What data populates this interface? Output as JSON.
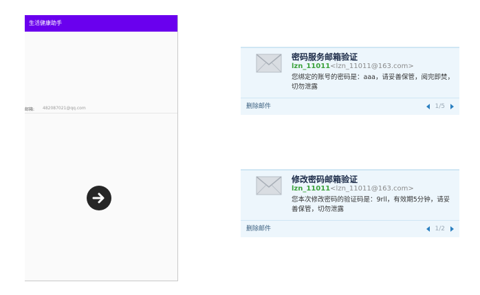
{
  "app": {
    "title": "生活健康助手",
    "email_label": "邮箱:",
    "email_value": "482087021@qq.com"
  },
  "mails": [
    {
      "subject": "密码服务邮箱验证",
      "sender_name": "lzn_11011",
      "sender_address": "<lzn_11011@163.com>",
      "message": "您绑定的账号的密码是：aaa，请妥善保管，阅完即焚，切勿泄露",
      "delete_label": "删除邮件",
      "pager": "1/5"
    },
    {
      "subject": "修改密码邮箱验证",
      "sender_name": "lzn_11011",
      "sender_address": "<lzn_11011@163.com>",
      "message": "您本次修改密码的验证码是：9rll，有效期5分钟，请妥善保管，切勿泄露",
      "delete_label": "删除邮件",
      "pager": "1/2"
    }
  ]
}
